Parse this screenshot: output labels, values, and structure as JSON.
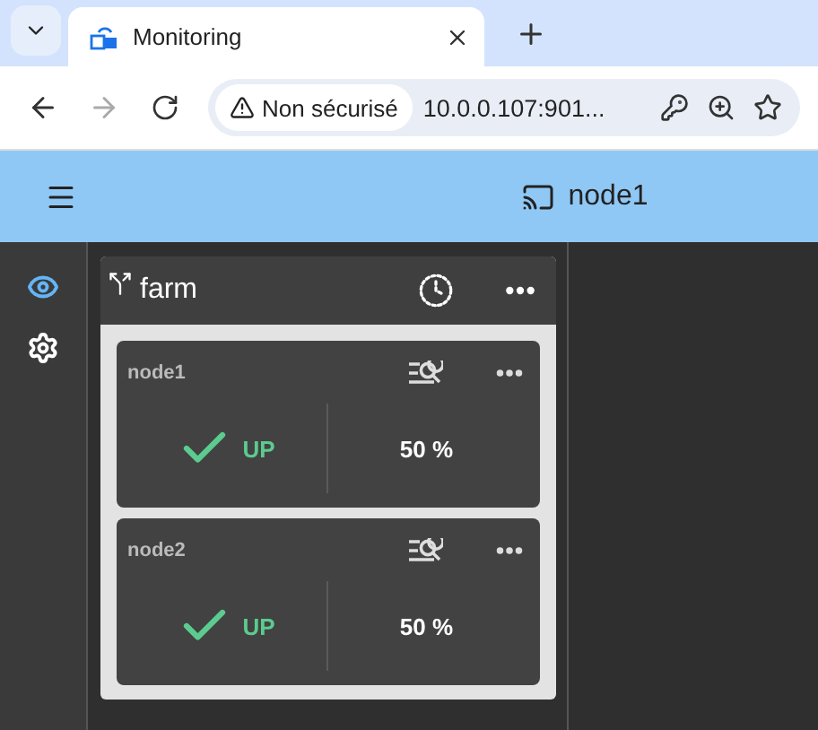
{
  "browser": {
    "tab": {
      "title": "Monitoring"
    },
    "security": "Non sécurisé",
    "url": "10.0.0.107:901..."
  },
  "header": {
    "title": "node1"
  },
  "sidebar": {
    "items": [
      {
        "selected": true
      },
      {
        "selected": false
      }
    ]
  },
  "group": {
    "title": "farm",
    "nodes": [
      {
        "name": "node1",
        "status": {
          "kind": "up",
          "label": "UP"
        },
        "value": "50 %"
      },
      {
        "name": "node2",
        "status": {
          "kind": "up",
          "label": "UP"
        },
        "value": "50 %"
      }
    ]
  }
}
